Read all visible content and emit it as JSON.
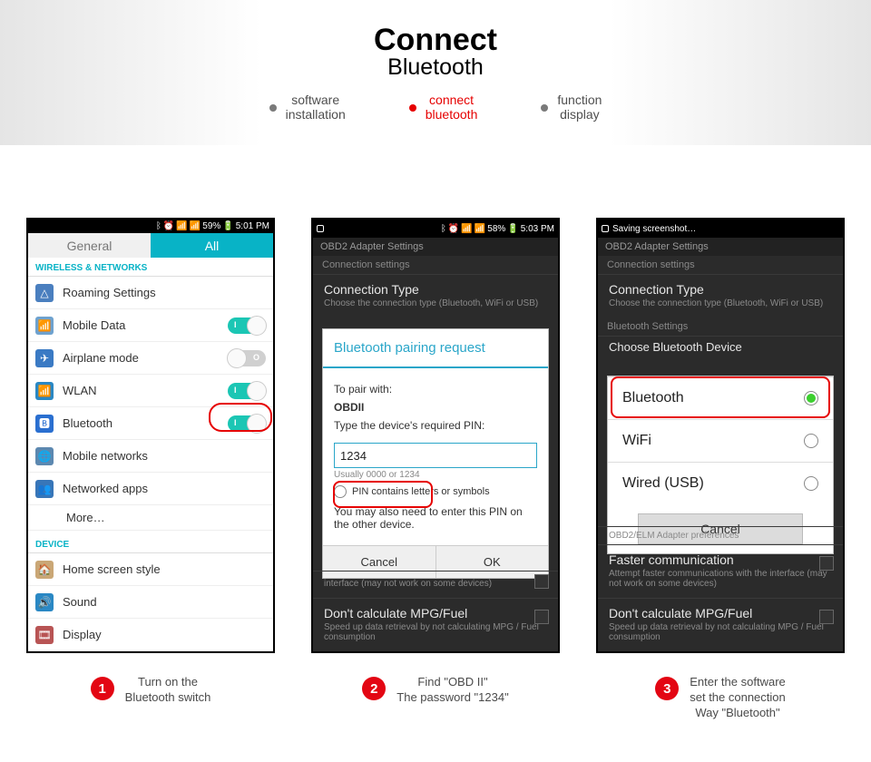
{
  "banner": {
    "title_main": "Connect",
    "title_sub": "Bluetooth",
    "tabs": [
      {
        "line1": "software",
        "line2": "installation",
        "active": false
      },
      {
        "line1": "connect",
        "line2": "bluetooth",
        "active": true
      },
      {
        "line1": "function",
        "line2": "display",
        "active": false
      }
    ]
  },
  "phone1": {
    "status": {
      "battery": "59%",
      "time": "5:01 PM"
    },
    "tabs": {
      "general": "General",
      "all": "All"
    },
    "section_wireless": "WIRELESS & NETWORKS",
    "rows": [
      {
        "key": "roaming",
        "label": "Roaming Settings",
        "icon_bg": "#4a7fbf",
        "icon_glyph": "△",
        "toggle": null
      },
      {
        "key": "mobile_data",
        "label": "Mobile Data",
        "icon_bg": "#6ea2cf",
        "icon_glyph": "📶",
        "toggle": "on"
      },
      {
        "key": "airplane",
        "label": "Airplane mode",
        "icon_bg": "#3a7ac4",
        "icon_glyph": "✈",
        "toggle": "off"
      },
      {
        "key": "wlan",
        "label": "WLAN",
        "icon_bg": "#2a88c4",
        "icon_glyph": "📶",
        "toggle": "on"
      },
      {
        "key": "bluetooth",
        "label": "Bluetooth",
        "icon_bg": "#2a6fd0",
        "icon_glyph": "🅱",
        "toggle": "on",
        "highlight": true
      },
      {
        "key": "mobile_networks",
        "label": "Mobile networks",
        "icon_bg": "#5c88b0",
        "icon_glyph": "🌐",
        "toggle": null
      },
      {
        "key": "networked_apps",
        "label": "Networked apps",
        "icon_bg": "#3876b8",
        "icon_glyph": "👥",
        "toggle": null
      }
    ],
    "more": "More…",
    "section_device": "DEVICE",
    "device_rows": [
      {
        "key": "home_screen",
        "label": "Home screen style",
        "icon_bg": "#caa776",
        "icon_glyph": "🏠"
      },
      {
        "key": "sound",
        "label": "Sound",
        "icon_bg": "#2a88c4",
        "icon_glyph": "🔊"
      },
      {
        "key": "display",
        "label": "Display",
        "icon_bg": "#b85454",
        "icon_glyph": "🎞"
      }
    ]
  },
  "phone2": {
    "status": {
      "battery": "58%",
      "time": "5:03 PM"
    },
    "header": "OBD2 Adapter Settings",
    "subhead": "Connection settings",
    "row1_title": "Connection Type",
    "row1_sub": "Choose the connection type (Bluetooth, WiFi or USB)",
    "popup": {
      "title": "Bluetooth pairing request",
      "pair_with_label": "To pair with:",
      "pair_with_value": "OBDII",
      "pin_label": "Type the device's required PIN:",
      "pin_value": "1234",
      "pin_hint": "Usually 0000 or 1234",
      "checkbox_label": "PIN contains letters or symbols",
      "note": "You may also need to enter this PIN on the other device.",
      "cancel": "Cancel",
      "ok": "OK"
    },
    "bottom_rows": [
      {
        "title_frag": "interface (may not work on some devices)"
      },
      {
        "title": "Don't calculate MPG/Fuel",
        "sub": "Speed up data retrieval by not calculating MPG / Fuel consumption"
      }
    ]
  },
  "phone3": {
    "status": {
      "saving": "Saving screenshot…"
    },
    "header": "OBD2 Adapter Settings",
    "subhead": "Connection settings",
    "row1_title": "Connection Type",
    "row1_sub": "Choose the connection type (Bluetooth, WiFi or USB)",
    "bt_section": "Bluetooth Settings",
    "bt_choose": "Choose Bluetooth Device",
    "options": [
      {
        "label": "Bluetooth",
        "selected": true
      },
      {
        "label": "WiFi",
        "selected": false
      },
      {
        "label": "Wired (USB)",
        "selected": false
      }
    ],
    "cancel": "Cancel",
    "bottom_rows": [
      {
        "title_frag": "OBD2/ELM Adapter preferences"
      },
      {
        "title": "Faster communication",
        "sub": "Attempt faster communications with the interface (may not work on some devices)"
      },
      {
        "title": "Don't calculate MPG/Fuel",
        "sub": "Speed up data retrieval by not calculating MPG / Fuel consumption"
      }
    ]
  },
  "captions": [
    {
      "num": "1",
      "line1": "Turn on the",
      "line2": "Bluetooth switch"
    },
    {
      "num": "2",
      "line1": "Find  \"OBD II\"",
      "line2": "The password \"1234\""
    },
    {
      "num": "3",
      "line1": "Enter the software",
      "line2": "set the connection",
      "line3": "Way \"Bluetooth\""
    }
  ]
}
